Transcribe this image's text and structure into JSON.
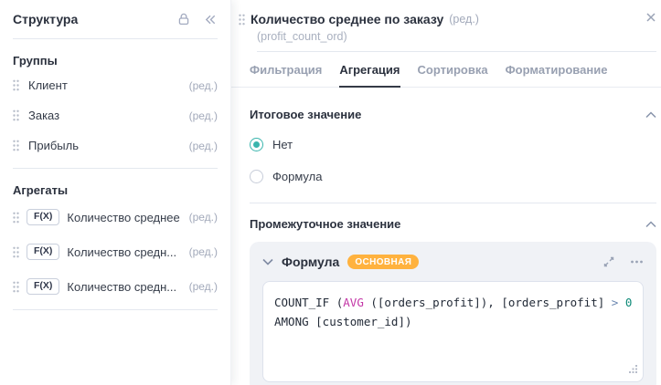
{
  "sidebar": {
    "title": "Структура",
    "groups_heading": "Группы",
    "groups": [
      {
        "label": "Клиент",
        "edit": "(ред.)"
      },
      {
        "label": "Заказ",
        "edit": "(ред.)"
      },
      {
        "label": "Прибыль",
        "edit": "(ред.)"
      }
    ],
    "aggregates_heading": "Агрегаты",
    "aggregates": [
      {
        "badge": "F(X)",
        "label": "Количество среднее",
        "edit": "(ред.)"
      },
      {
        "badge": "F(X)",
        "label": "Количество средн...",
        "edit": "(ред.)"
      },
      {
        "badge": "F(X)",
        "label": "Количество средн...",
        "edit": "(ред.)"
      }
    ]
  },
  "panel": {
    "title": "Количество среднее по заказу",
    "title_edit": "(ред.)",
    "subtitle": "(profit_count_ord)",
    "tabs": [
      {
        "label": "Фильтрация",
        "active": false
      },
      {
        "label": "Агрегация",
        "active": true
      },
      {
        "label": "Сортировка",
        "active": false
      },
      {
        "label": "Форматирование",
        "active": false
      }
    ],
    "total_section": {
      "heading": "Итоговое значение",
      "options": [
        {
          "label": "Нет",
          "selected": true
        },
        {
          "label": "Формула",
          "selected": false
        }
      ]
    },
    "intermediate_section": {
      "heading": "Промежуточное значение",
      "card": {
        "title": "Формула",
        "badge": "ОСНОВНАЯ"
      }
    },
    "formula": {
      "lines": [
        [
          {
            "text": "COUNT_IF (",
            "cls": "t-default"
          },
          {
            "text": "AVG",
            "cls": "t-func"
          },
          {
            "text": " ([orders_profit]), [orders_profit] ",
            "cls": "t-default"
          },
          {
            "text": ">",
            "cls": "t-op"
          },
          {
            "text": " ",
            "cls": "t-default"
          },
          {
            "text": "0",
            "cls": "t-num"
          }
        ],
        [
          {
            "text": "AMONG [customer_id])",
            "cls": "t-default"
          }
        ]
      ]
    }
  },
  "colors": {
    "radio_selected": "#3ab5ad",
    "badge_orange": "#ffb23e",
    "active_tab_underline": "#343a46",
    "code_function": "#c336a6",
    "code_number": "#0e8a78",
    "code_operator": "#6b87b0",
    "icon_gray": "#a3abc0"
  }
}
